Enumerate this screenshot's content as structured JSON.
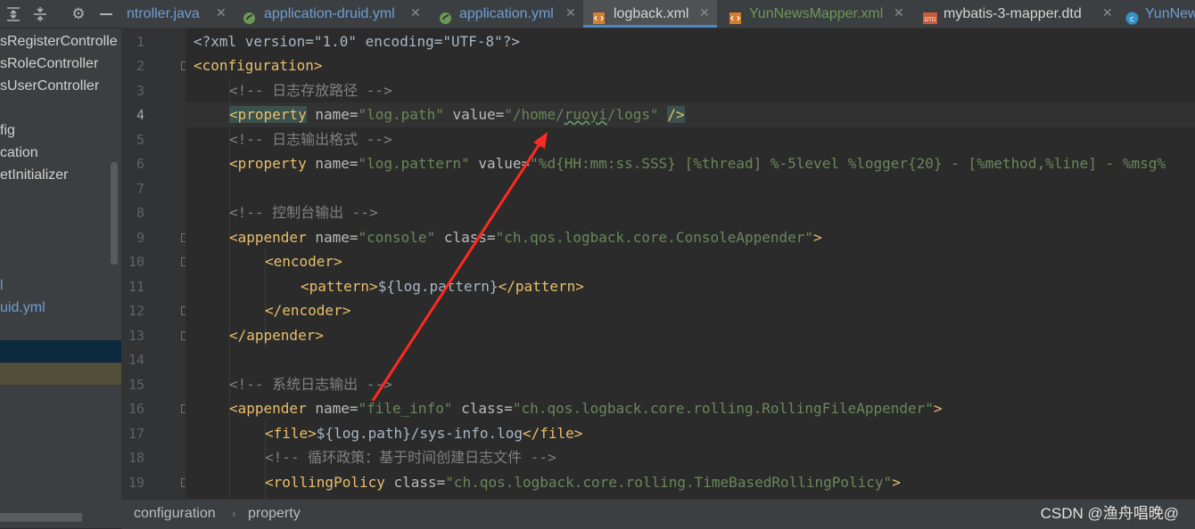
{
  "toolbar": {
    "icons": [
      "expand-all-icon",
      "collapse-all-icon",
      "gear-icon",
      "minimize-icon"
    ]
  },
  "tabs": [
    {
      "label": "ntroller.java",
      "icon": "java-class-icon",
      "active": false
    },
    {
      "label": "application-druid.yml",
      "icon": "spring-yml-icon",
      "active": false
    },
    {
      "label": "application.yml",
      "icon": "spring-yml-icon",
      "active": false
    },
    {
      "label": "logback.xml",
      "icon": "xml-file-icon",
      "active": true
    },
    {
      "label": "YunNewsMapper.xml",
      "icon": "xml-file-icon",
      "active": false
    },
    {
      "label": "mybatis-3-mapper.dtd",
      "icon": "dtd-file-icon",
      "active": false
    },
    {
      "label": "YunNew",
      "icon": "class-c-icon",
      "active": false
    }
  ],
  "sidebar": {
    "items": [
      {
        "label": "sRegisterControlle"
      },
      {
        "label": "sRoleController"
      },
      {
        "label": "sUserController"
      },
      {
        "label": "fig"
      },
      {
        "label": "cation"
      },
      {
        "label": "etInitializer"
      },
      {
        "label": "l"
      },
      {
        "label": "uid.yml"
      }
    ]
  },
  "editor": {
    "line_numbers": [
      "1",
      "2",
      "3",
      "4",
      "5",
      "6",
      "7",
      "8",
      "9",
      "10",
      "11",
      "12",
      "13",
      "14",
      "15",
      "16",
      "17",
      "18",
      "19"
    ],
    "current_line": "4",
    "lines": {
      "l1": {
        "decl": "<?xml version=\"1.0\" encoding=\"UTF-8\"?>"
      },
      "l2": {
        "open": "<configuration>"
      },
      "l3": {
        "comment": "<!-- 日志存放路径 -->"
      },
      "l4": {
        "tag": "<property",
        "attr1": " name=",
        "val1": "\"log.path\"",
        "attr2": " value=",
        "val2a": "\"/home/",
        "val2b": "ruoyi",
        "val2c": "/logs\"",
        "close": "/>"
      },
      "l5": {
        "comment": "<!-- 日志输出格式 -->"
      },
      "l6": {
        "tag": "<property",
        "attr1": " name=",
        "val1": "\"log.pattern\"",
        "attr2": " value=",
        "val2": "\"%d{HH:mm:ss.SSS} [%thread] %-5level %logger{20} - [%method,%line] - %msg%"
      },
      "l8": {
        "comment": "<!-- 控制台输出 -->"
      },
      "l9": {
        "tag": "<appender",
        "attr1": " name=",
        "val1": "\"console\"",
        "attr2": " class=",
        "val2": "\"ch.qos.logback.core.ConsoleAppender\"",
        "close": ">"
      },
      "l10": {
        "tag": "<encoder>"
      },
      "l11": {
        "open": "<pattern>",
        "text": "${log.pattern}",
        "close": "</pattern>"
      },
      "l12": {
        "tag": "</encoder>"
      },
      "l13": {
        "tag": "</appender>"
      },
      "l15": {
        "comment": "<!-- 系统日志输出 -->"
      },
      "l16": {
        "tag": "<appender",
        "attr1": " name=",
        "val1": "\"file_info\"",
        "attr2": " class=",
        "val2": "\"ch.qos.logback.core.rolling.RollingFileAppender\"",
        "close": ">"
      },
      "l17": {
        "open": "<file>",
        "text": "${log.path}/sys-info.log",
        "close": "</file>"
      },
      "l18": {
        "comment": "<!-- 循环政策：基于时间创建日志文件 -->"
      },
      "l19": {
        "tag": "<rollingPolicy",
        "attr1": " class=",
        "val1": "\"ch.qos.logback.core.rolling.TimeBasedRollingPolicy\"",
        "close": ">"
      }
    }
  },
  "breadcrumb": {
    "items": [
      "configuration",
      "property"
    ],
    "separator": "›"
  },
  "watermark": "CSDN @渔舟唱晚@",
  "colors": {
    "annotation_arrow": "#ff2a1f",
    "active_tab_underline": "#4a88c7"
  }
}
